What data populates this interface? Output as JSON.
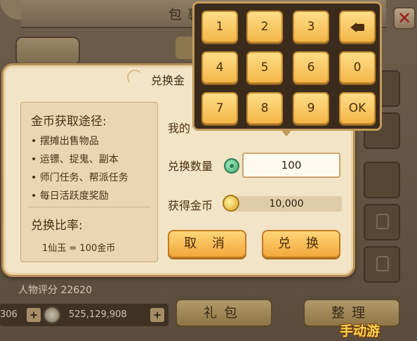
{
  "background": {
    "title": "包裹",
    "character_rating": "人物评分 22620",
    "currency_left": "306",
    "currency_right": "525,129,908",
    "gift_button": "礼包",
    "sort_button": "整理"
  },
  "dialog": {
    "title": "兑换金",
    "info_heading": "金币获取途径:",
    "info_items": [
      "• 摆摊出售物品",
      "• 运镖、捉鬼、副本",
      "• 师门任务、帮派任务",
      "• 每日活跃度奖励"
    ],
    "rate_heading": "兑换比率:",
    "rate_value": "1仙玉 = 100金币",
    "my_label": "我的",
    "amount_label": "兑换数量",
    "amount_value": "100",
    "gold_label": "获得金币",
    "gold_value": "10,000",
    "cancel_label": "取 消",
    "confirm_label": "兑 换"
  },
  "keypad": {
    "keys": [
      "1",
      "2",
      "3",
      "4",
      "5",
      "6",
      "0",
      "7",
      "8",
      "9",
      "OK"
    ]
  },
  "watermark": "手动游"
}
